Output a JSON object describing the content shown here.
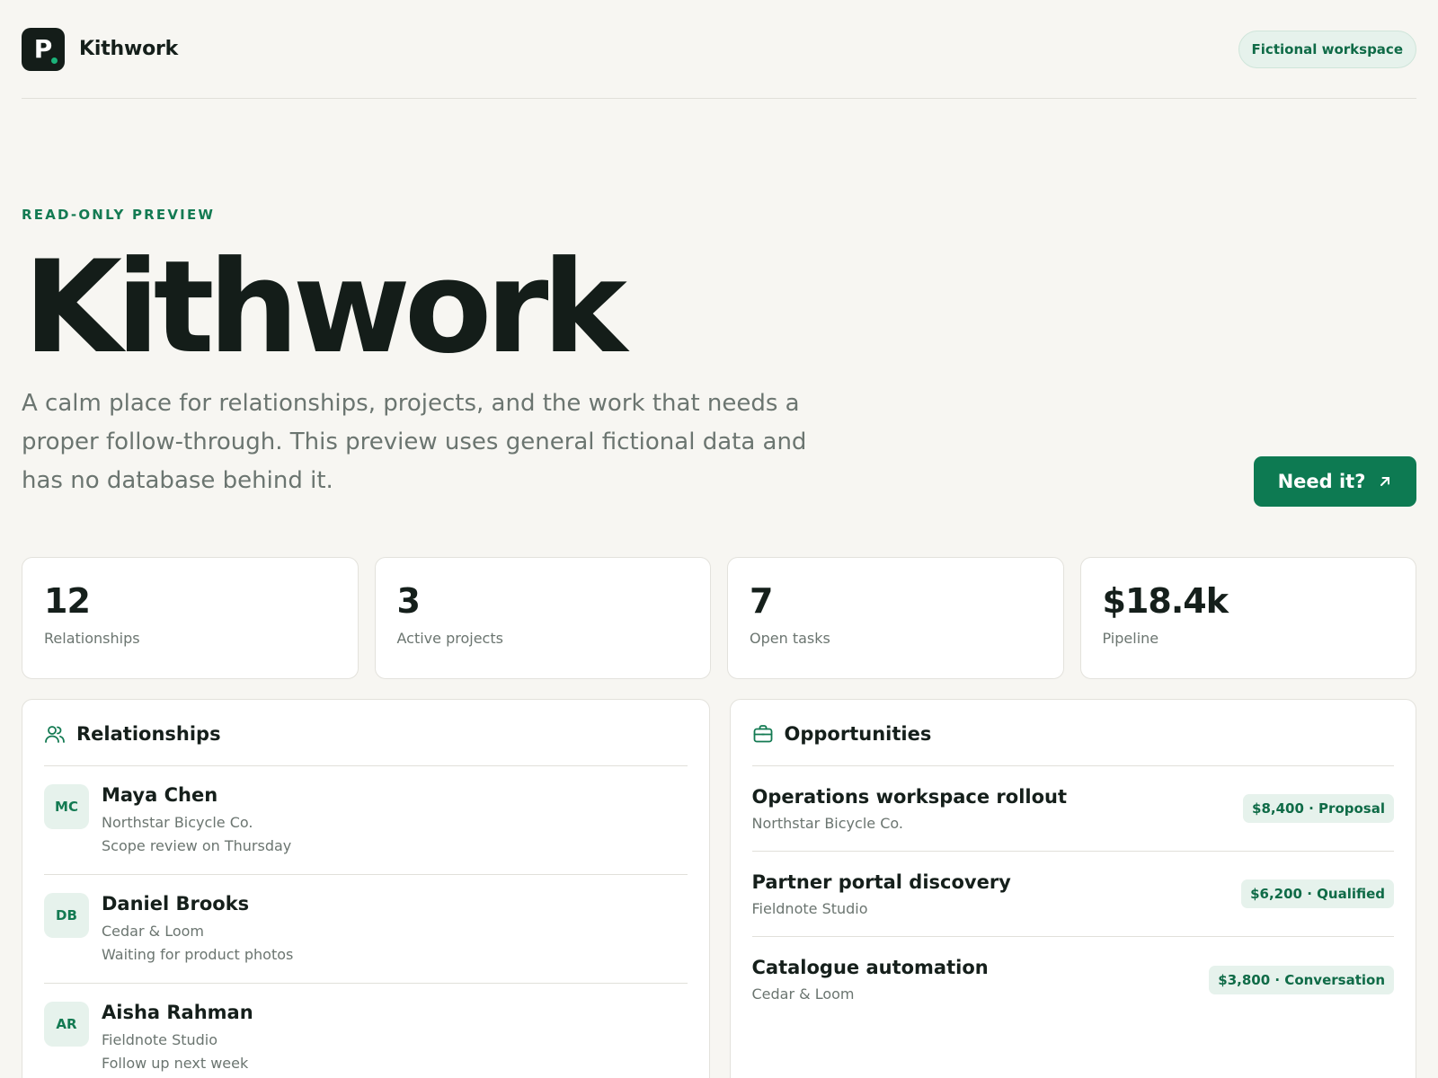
{
  "header": {
    "logo_letter": "P",
    "brand_name": "Kithwork",
    "workspace_badge": "Fictional workspace"
  },
  "hero": {
    "eyebrow": "READ-ONLY PREVIEW",
    "title": "Kithwork",
    "description": "A calm place for relationships, projects, and the work that needs a proper follow-through. This preview uses general fictional data and has no database behind it.",
    "cta_label": "Need it?",
    "cta_icon": "arrow-up-right-icon"
  },
  "stats": [
    {
      "value": "12",
      "label": "Relationships"
    },
    {
      "value": "3",
      "label": "Active projects"
    },
    {
      "value": "7",
      "label": "Open tasks"
    },
    {
      "value": "$18.4k",
      "label": "Pipeline"
    }
  ],
  "relationships": {
    "title": "Relationships",
    "icon": "users-icon",
    "items": [
      {
        "initials": "MC",
        "name": "Maya Chen",
        "company": "Northstar Bicycle Co.",
        "note": "Scope review on Thursday"
      },
      {
        "initials": "DB",
        "name": "Daniel Brooks",
        "company": "Cedar & Loom",
        "note": "Waiting for product photos"
      },
      {
        "initials": "AR",
        "name": "Aisha Rahman",
        "company": "Fieldnote Studio",
        "note": "Follow up next week"
      }
    ]
  },
  "opportunities": {
    "title": "Opportunities",
    "icon": "briefcase-icon",
    "items": [
      {
        "name": "Operations workspace rollout",
        "company": "Northstar Bicycle Co.",
        "badge": "$8,400 · Proposal"
      },
      {
        "name": "Partner portal discovery",
        "company": "Fieldnote Studio",
        "badge": "$6,200 · Qualified"
      },
      {
        "name": "Catalogue automation",
        "company": "Cedar & Loom",
        "badge": "$3,800 · Conversation"
      }
    ]
  },
  "colors": {
    "accent": "#0d7a52",
    "background": "#f7f6f2",
    "badge_bg": "#e6f2ec"
  }
}
